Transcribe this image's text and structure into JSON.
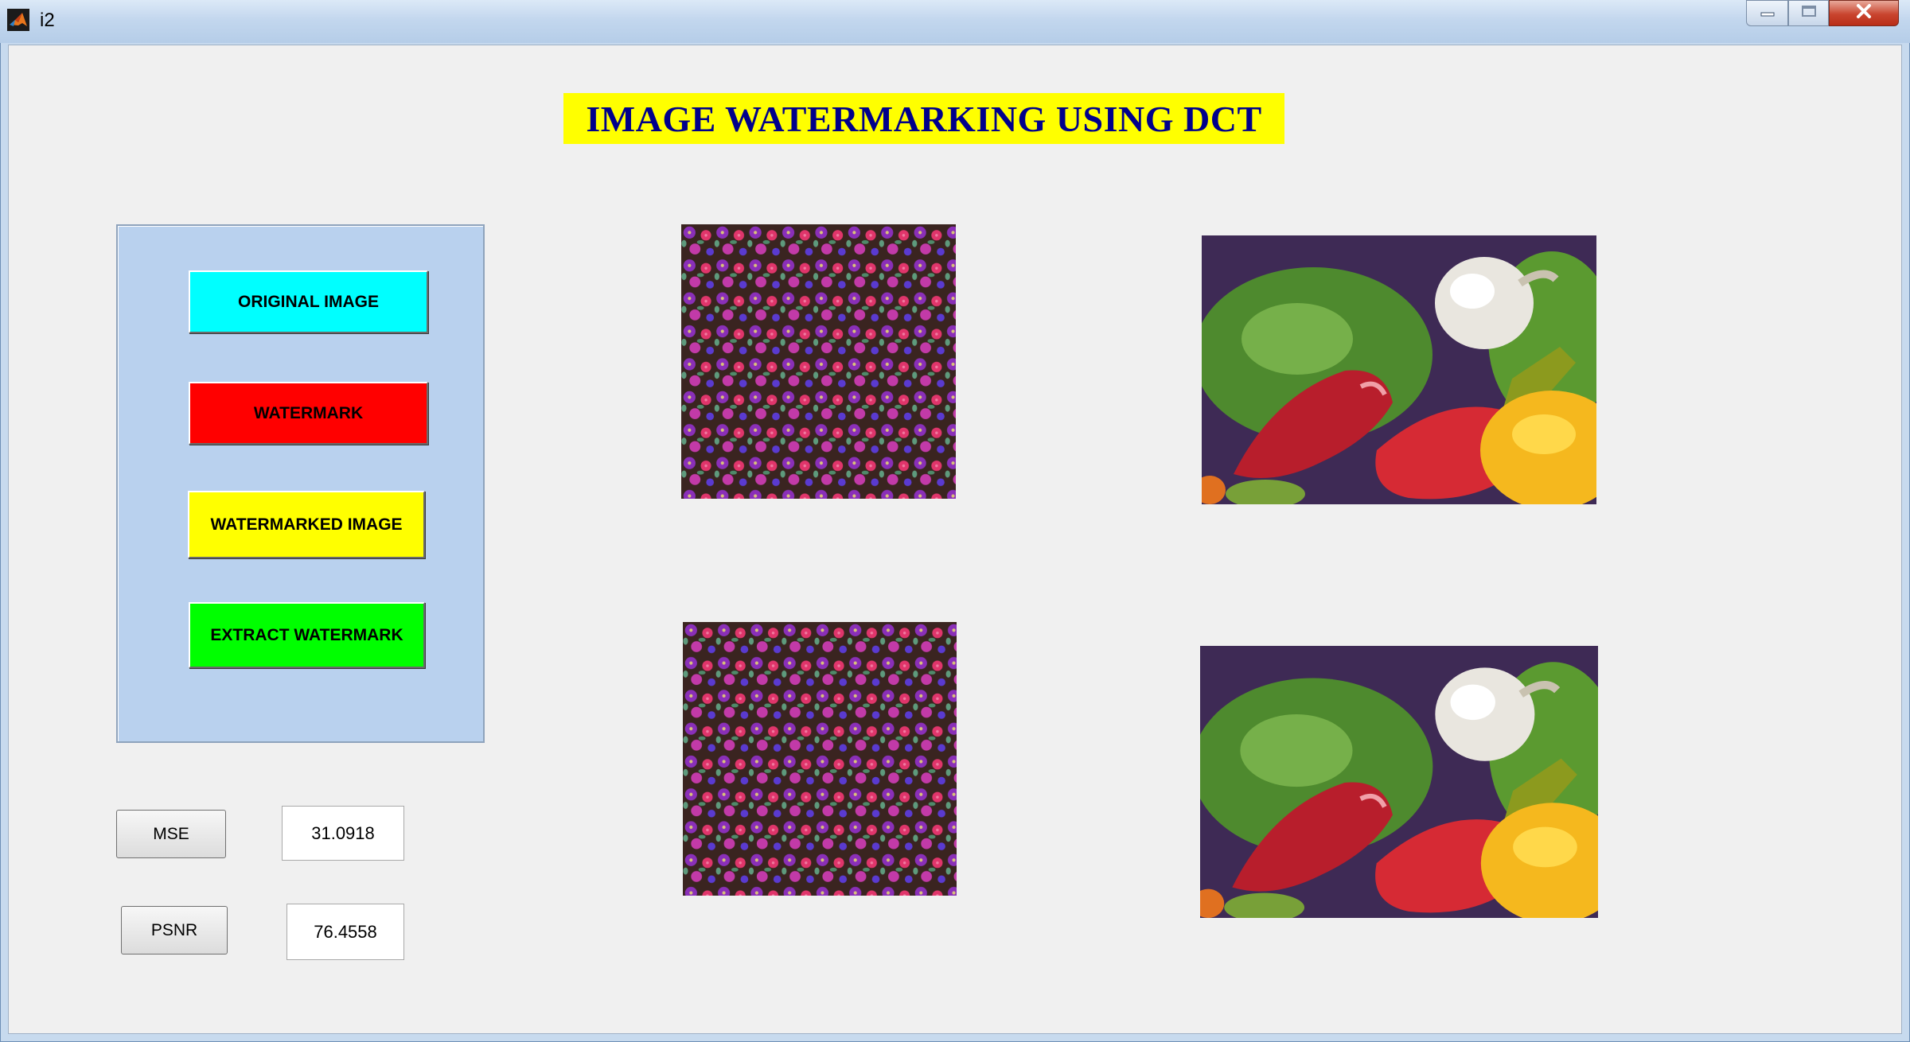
{
  "window": {
    "title": "i2"
  },
  "heading": "IMAGE WATERMARKING USING DCT",
  "buttons": {
    "original": "ORIGINAL IMAGE",
    "watermark": "WATERMARK",
    "watermarked": "WATERMARKED IMAGE",
    "extract": "EXTRACT WATERMARK",
    "mse": "MSE",
    "psnr": "PSNR"
  },
  "values": {
    "mse": "31.0918",
    "psnr": "76.4558"
  },
  "colors": {
    "heading_bg": "#ffff00",
    "heading_text": "#00008b",
    "panel_bg": "#b9d1ee",
    "original_btn": "#00ffff",
    "watermark_btn": "#ff0000",
    "watermarked_btn": "#ffff00",
    "extract_btn": "#00ff00"
  },
  "icons": [
    "matlab-icon",
    "minimize-icon",
    "maximize-icon",
    "close-icon"
  ]
}
